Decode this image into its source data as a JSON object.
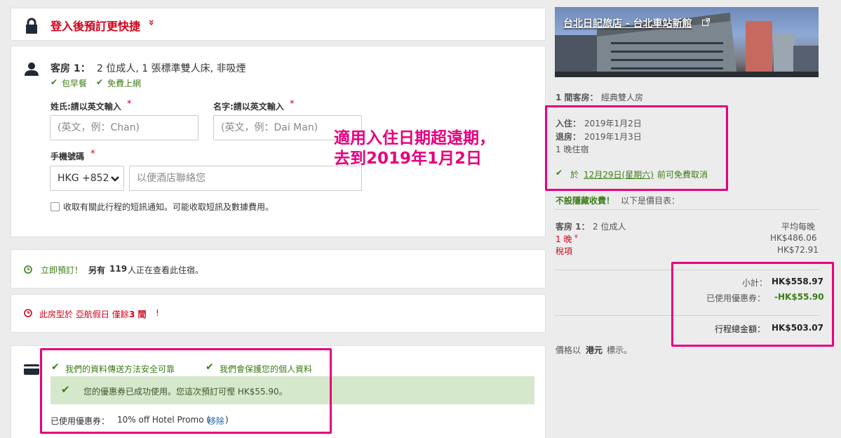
{
  "login_banner": {
    "text": "登入後預訂更快捷",
    "chevron": "»"
  },
  "guest": {
    "room_label": "客房 1：",
    "room_desc": "2 位成人, 1 張標準雙人床, 非吸煙",
    "perk1": "包早餐",
    "perk2": "免費上網",
    "lastname_label": "姓氏:請以英文輸入",
    "lastname_placeholder": "(英文，例：Chan)",
    "firstname_label": "名字:請以英文輸入",
    "firstname_placeholder": "(英文，例：Dai Man)",
    "required_mark": "*",
    "phone_label": "手機號碼",
    "phone_code": "HKG +852",
    "phone_placeholder": "以便酒店聯絡您",
    "sms_label": "收取有關此行程的短訊通知。可能收取短訊及數據費用。"
  },
  "viewing": {
    "prefix": "立即預訂！",
    "text_a": "另有",
    "count": "119",
    "text_b": "人正在查看此住宿。"
  },
  "scarcity": {
    "text_a": "此房型於 亞航假日 僅餘",
    "count": "3 間",
    "text_b": "!"
  },
  "payment": {
    "secure1": "我們的資料傳送方法安全可靠",
    "secure2": "我們會保護您的個人資料",
    "coupon_success": "您的優惠券已成功使用。您這次預訂可慳 HK$55.90。",
    "coupon_label": "已使用優惠券：",
    "coupon_name": "10% off Hotel Promo (",
    "coupon_remove": "移除",
    "coupon_close": ")"
  },
  "annotation": {
    "line1": "適用入住日期超遠期，",
    "line2": "去到2019年1月2日"
  },
  "hotel": {
    "name": "台北日記旅店 - 台北車站新館",
    "rooms_label": "1 間客房：",
    "room_type": "經典雙人房",
    "checkin_label": "入住：",
    "checkin": "2019年1月2日",
    "checkout_label": "退房：",
    "checkout": "2019年1月3日",
    "nights": "1 晚住宿",
    "cancel_prefix": "於",
    "cancel_date": "12月29日(星期六)",
    "cancel_suffix": "前可免費取消",
    "no_hidden": "不設隱藏收費！",
    "price_list": "以下是價目表：",
    "price_room_label": "客房 1：",
    "price_room_desc": "2 位成人",
    "avg_label": "平均每晚",
    "night_label": "1 晚",
    "night_price": "HK$486.06",
    "tax_label": "稅項",
    "tax": "HK$72.91",
    "subtotal_label": "小計：",
    "subtotal": "HK$558.97",
    "coupon_label": "已使用優惠券：",
    "coupon": "-HK$55.90",
    "total_label": "行程總金額：",
    "total": "HK$503.07",
    "currency_note_a": "價格以",
    "currency": "港元",
    "currency_note_b": "標示。"
  },
  "colors": {
    "accent_red": "#d0021b",
    "success_green": "#3b7d16",
    "annotation_pink": "#e6007e",
    "link_blue": "#1a66b8"
  }
}
